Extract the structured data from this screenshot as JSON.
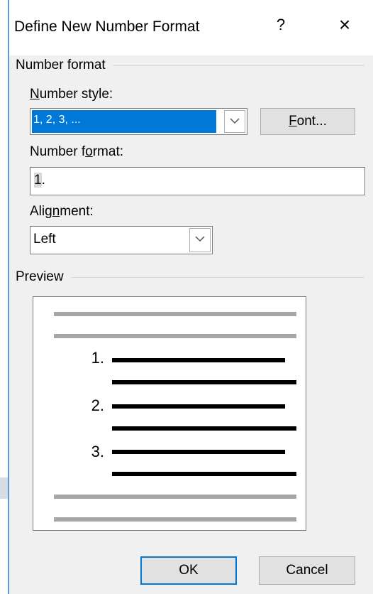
{
  "dialog": {
    "title": "Define New Number Format",
    "help_label": "?",
    "close_label": "×"
  },
  "number_format_group": {
    "label": "Number format",
    "number_style": {
      "label_prefix": "",
      "label_access": "N",
      "label_rest": "umber style:",
      "value": "1, 2, 3, ..."
    },
    "font_button": {
      "access": "F",
      "rest": "ont..."
    },
    "number_format": {
      "label_pre": "Number f",
      "label_access": "o",
      "label_post": "rmat:",
      "value_highlight": "1",
      "value_rest": "."
    },
    "alignment": {
      "label_pre": "Alig",
      "label_access": "n",
      "label_post": "ment:",
      "value": "Left"
    }
  },
  "preview_group": {
    "label": "Preview",
    "numbers": [
      "1.",
      "2.",
      "3."
    ],
    "colors": {
      "gray_line": "#a6a6a6",
      "black_line": "#000000"
    }
  },
  "buttons": {
    "ok": "OK",
    "cancel": "Cancel"
  },
  "colors": {
    "accent": "#0078d7",
    "dialog_bg": "#f0f0f0",
    "window_border": "#5b9bd5"
  }
}
